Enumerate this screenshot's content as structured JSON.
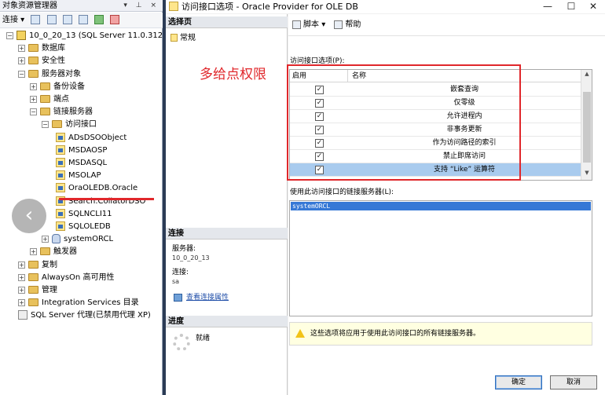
{
  "object_explorer": {
    "title": "对象资源管理器",
    "title_controls": "▾ ⊥ ×",
    "connect_label": "连接 ▾",
    "tree": [
      {
        "label": "10_0_20_13 (SQL Server 11.0.3128 -",
        "exp": "−",
        "icon": "server",
        "indent": 0
      },
      {
        "label": "数据库",
        "exp": "+",
        "icon": "folder",
        "indent": 1
      },
      {
        "label": "安全性",
        "exp": "+",
        "icon": "folder",
        "indent": 1
      },
      {
        "label": "服务器对象",
        "exp": "−",
        "icon": "folder",
        "indent": 1
      },
      {
        "label": "备份设备",
        "exp": "+",
        "icon": "folder",
        "indent": 2
      },
      {
        "label": "端点",
        "exp": "+",
        "icon": "folder",
        "indent": 2
      },
      {
        "label": "链接服务器",
        "exp": "−",
        "icon": "folder",
        "indent": 2
      },
      {
        "label": "访问接口",
        "exp": "−",
        "icon": "folder",
        "indent": 3
      },
      {
        "label": "ADsDSOObject",
        "exp": "",
        "icon": "provider",
        "indent": 4
      },
      {
        "label": "MSDAOSP",
        "exp": "",
        "icon": "provider",
        "indent": 4
      },
      {
        "label": "MSDASQL",
        "exp": "",
        "icon": "provider",
        "indent": 4
      },
      {
        "label": "MSOLAP",
        "exp": "",
        "icon": "provider",
        "indent": 4
      },
      {
        "label": "OraOLEDB.Oracle",
        "exp": "",
        "icon": "provider",
        "indent": 4
      },
      {
        "label": "Search.CollatorDSO",
        "exp": "",
        "icon": "provider",
        "indent": 4
      },
      {
        "label": "SQLNCLI11",
        "exp": "",
        "icon": "provider",
        "indent": 4
      },
      {
        "label": "SQLOLEDB",
        "exp": "",
        "icon": "provider",
        "indent": 4
      },
      {
        "label": "systemORCL",
        "exp": "+",
        "icon": "db",
        "indent": 3
      },
      {
        "label": "触发器",
        "exp": "+",
        "icon": "folder",
        "indent": 2
      },
      {
        "label": "复制",
        "exp": "+",
        "icon": "folder",
        "indent": 1
      },
      {
        "label": "AlwaysOn 高可用性",
        "exp": "+",
        "icon": "folder",
        "indent": 1
      },
      {
        "label": "管理",
        "exp": "+",
        "icon": "folder",
        "indent": 1
      },
      {
        "label": "Integration Services 目录",
        "exp": "+",
        "icon": "folder",
        "indent": 1
      },
      {
        "label": "SQL Server 代理(已禁用代理 XP)",
        "exp": "",
        "icon": "agent",
        "indent": 1
      }
    ],
    "back_glyph": "‹"
  },
  "dialog": {
    "title": "访问接口选项 - Oracle Provider for OLE DB",
    "window_controls": {
      "minimize": "—",
      "maximize": "☐",
      "close": "✕"
    },
    "pages_header": "选择页",
    "pages": [
      {
        "label": "常规"
      }
    ],
    "connection_header": "连接",
    "server_label": "服务器:",
    "server_value": "10_0_20_13",
    "connection_label": "连接:",
    "connection_value": "sa",
    "view_connection_link": "查看连接属性",
    "progress_header": "进度",
    "progress_status": "就绪",
    "toolbar": {
      "script_label": "脚本",
      "script_arrow": "▾",
      "help_label": "帮助"
    },
    "options_label": "访问接口选项(P):",
    "grid_headers": {
      "enabled": "启用",
      "name": "名称"
    },
    "options": [
      {
        "name": "嵌套查询",
        "checked": true,
        "selected": false
      },
      {
        "name": "仅零级",
        "checked": true,
        "selected": false
      },
      {
        "name": "允许进程内",
        "checked": true,
        "selected": false
      },
      {
        "name": "非事务更新",
        "checked": true,
        "selected": false
      },
      {
        "name": "作为访问路径的索引",
        "checked": true,
        "selected": false
      },
      {
        "name": "禁止即席访问",
        "checked": true,
        "selected": false
      },
      {
        "name": "支持 “Like” 运算符",
        "checked": true,
        "selected": true
      }
    ],
    "linked_servers_label": "使用此访问接口的链接服务器(L):",
    "linked_servers": [
      "systemORCL"
    ],
    "warning_text": "这些选项将应用于使用此访问接口的所有链接服务器。",
    "ok_label": "确定",
    "cancel_label": "取消"
  },
  "annotation": {
    "text": "多给点权限",
    "color": "#e0272b"
  }
}
